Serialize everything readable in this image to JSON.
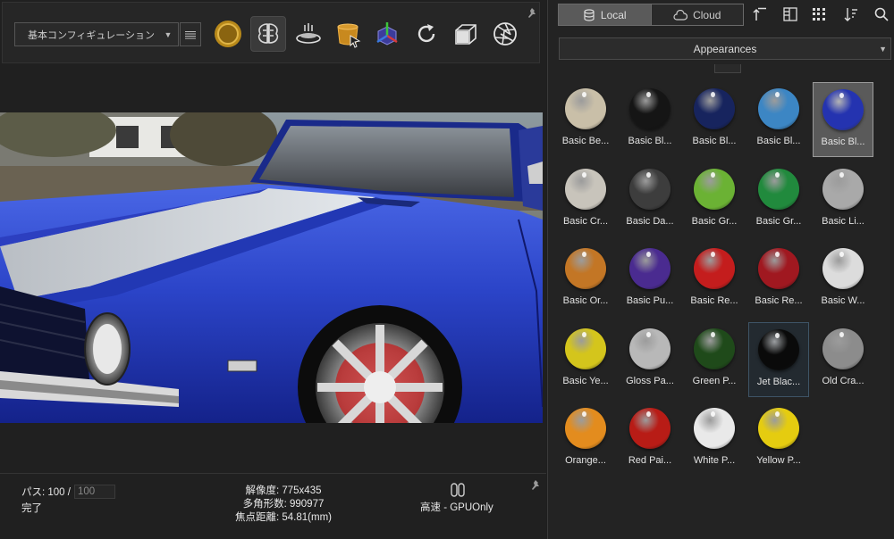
{
  "toolbar": {
    "config_label": "基本コンフィギュレーション",
    "buttons": [
      {
        "name": "render-mode-icon"
      },
      {
        "name": "brain-ai-icon"
      },
      {
        "name": "turntable-icon"
      },
      {
        "name": "material-bucket-icon"
      },
      {
        "name": "scene-axes-icon"
      },
      {
        "name": "refresh-icon"
      },
      {
        "name": "camera-cube-icon"
      },
      {
        "name": "aperture-icon"
      }
    ]
  },
  "status": {
    "pass_label": "パス: 100 / ",
    "pass_total": "100",
    "done": "完了",
    "resolution": "解像度: 775x435",
    "polygons": "多角形数: 990977",
    "focus": "焦点距離: 54.81(mm)",
    "mode": "高速 - GPUOnly"
  },
  "library": {
    "tabs": [
      {
        "label": "Local"
      },
      {
        "label": "Cloud"
      }
    ],
    "active_tab": "Local",
    "category": "Appearances",
    "items": [
      {
        "label": "Basic Be...",
        "color": "#c9bfa8"
      },
      {
        "label": "Basic Bl...",
        "color": "#151515"
      },
      {
        "label": "Basic Bl...",
        "color": "#17245e"
      },
      {
        "label": "Basic Bl...",
        "color": "#3c86c4"
      },
      {
        "label": "Basic Bl...",
        "color": "#2433b0",
        "state": "selected"
      },
      {
        "label": "Basic Cr...",
        "color": "#c8c4bb"
      },
      {
        "label": "Basic Da...",
        "color": "#3d3d3d"
      },
      {
        "label": "Basic Gr...",
        "color": "#6bb234"
      },
      {
        "label": "Basic Gr...",
        "color": "#218a3d"
      },
      {
        "label": "Basic Li...",
        "color": "#a9a9a9"
      },
      {
        "label": "Basic Or...",
        "color": "#c37625"
      },
      {
        "label": "Basic Pu...",
        "color": "#4a2b90"
      },
      {
        "label": "Basic Re...",
        "color": "#c41d1d"
      },
      {
        "label": "Basic Re...",
        "color": "#a01820"
      },
      {
        "label": "Basic W...",
        "color": "#dcdcdc"
      },
      {
        "label": "Basic Ye...",
        "color": "#d4c51c"
      },
      {
        "label": "Gloss Pa...",
        "color": "#b8b8b8"
      },
      {
        "label": "Green P...",
        "color": "#1f4a1a"
      },
      {
        "label": "Jet Blac...",
        "color": "#0a0a0a",
        "state": "hover"
      },
      {
        "label": "Old Cra...",
        "color": "#8c8c8c"
      },
      {
        "label": "Orange...",
        "color": "#e38c1e"
      },
      {
        "label": "Red Pai...",
        "color": "#b81c16"
      },
      {
        "label": "White P...",
        "color": "#e9e9e9"
      },
      {
        "label": "Yellow P...",
        "color": "#e5cc10"
      }
    ]
  }
}
